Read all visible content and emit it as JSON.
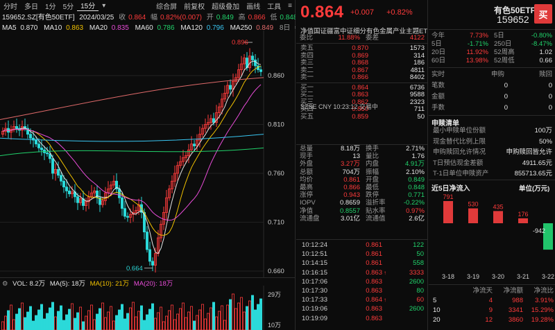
{
  "toolbar": {
    "tabs": [
      "分时",
      "多日",
      "1分",
      "5分",
      "15分"
    ],
    "selected_tab": "15分",
    "right_items": [
      "综合屏",
      "前复权",
      "超级叠加",
      "画线",
      "工具"
    ]
  },
  "info": {
    "symbol": "159652.SZ[有色50ETF]",
    "date": "2024/03/25",
    "close_label": "收",
    "close": "0.864",
    "amp_label": "幅",
    "amp": "0.82%(0.007)",
    "open_label": "开",
    "open": "0.849",
    "high_label": "高",
    "high": "0.866",
    "low_label": "低",
    "low": "0.848"
  },
  "ma": [
    {
      "label": "MA5",
      "value": "0.870",
      "color": "#e6e6e6"
    },
    {
      "label": "MA10",
      "value": "0.863",
      "color": "#f2c200"
    },
    {
      "label": "MA20",
      "value": "0.835",
      "color": "#e84cd8"
    },
    {
      "label": "MA60",
      "value": "0.786",
      "color": "#21d36b"
    },
    {
      "label": "MA120",
      "value": "0.796",
      "color": "#39c6f2"
    },
    {
      "label": "MA250",
      "value": "0.849",
      "color": "#e06a6a"
    }
  ],
  "ma_extra": "8日",
  "price_axis": [
    "0.860",
    "0.810",
    "0.760",
    "0.710",
    "0.660"
  ],
  "kline_marks": {
    "high": "0.896",
    "low": "0.664"
  },
  "volume": {
    "vol": "VOL: 8.2万",
    "ma5": "MA(5): 18万",
    "ma10": "MA(10): 21万",
    "ma20": "MA(20): 18万",
    "axis_top": "29万",
    "axis_mid": "10万"
  },
  "quote": {
    "price": "0.864",
    "change": "+0.007",
    "pct": "+0.82%",
    "fund_name": "净值国证疆富中证细分有色金属产业主题ET",
    "webi_label": "委比",
    "webi": "11.88%",
    "weicha_label": "委差",
    "weicha": "4122"
  },
  "sells": [
    {
      "label": "卖五",
      "price": "0.870",
      "vol": "1573"
    },
    {
      "label": "卖四",
      "price": "0.869",
      "vol": "314"
    },
    {
      "label": "卖三",
      "price": "0.868",
      "vol": "186"
    },
    {
      "label": "卖二",
      "price": "0.867",
      "vol": "4811"
    },
    {
      "label": "卖一",
      "price": "0.866",
      "vol": "8402"
    }
  ],
  "buys": [
    {
      "label": "买一",
      "price": "0.864",
      "vol": "6736"
    },
    {
      "label": "买二",
      "price": "0.863",
      "vol": "9588"
    },
    {
      "label": "买三",
      "price": "0.862",
      "vol": "2323"
    },
    {
      "label": "买四",
      "price": "0.860",
      "vol": "711"
    },
    {
      "label": "买五",
      "price": "0.859",
      "vol": "50"
    }
  ],
  "tz": "SZSE  CNY  10:23:12  交易中",
  "stats": [
    {
      "l1": "总量",
      "v1": "8.18万",
      "c1": "white",
      "l2": "换手",
      "v2": "2.71%",
      "c2": "white"
    },
    {
      "l1": "现手",
      "v1": "13",
      "c1": "white",
      "l2": "量比",
      "v2": "1.76",
      "c2": "white"
    },
    {
      "l1": "外盘",
      "v1": "3.27万",
      "c1": "red",
      "l2": "内盘",
      "v2": "4.91万",
      "c2": "green"
    },
    {
      "l1": "总额",
      "v1": "704万",
      "c1": "white",
      "l2": "振幅",
      "v2": "2.10%",
      "c2": "white"
    },
    {
      "l1": "均价",
      "v1": "0.861",
      "c1": "red",
      "l2": "开盘",
      "v2": "0.849",
      "c2": "green"
    },
    {
      "l1": "最高",
      "v1": "0.866",
      "c1": "red",
      "l2": "最低",
      "v2": "0.848",
      "c2": "green"
    },
    {
      "l1": "涨停",
      "v1": "0.943",
      "c1": "red",
      "l2": "跌停",
      "v2": "0.771",
      "c2": "green"
    },
    {
      "l1": "IOPV",
      "v1": "0.8659",
      "c1": "white",
      "l2": "溢折率",
      "v2": "-0.22%",
      "c2": "green"
    },
    {
      "l1": "净值",
      "v1": "0.8557",
      "c1": "green",
      "l2": "贴水率",
      "v2": "0.97%",
      "c2": "red"
    },
    {
      "l1": "流通盘",
      "v1": "3.01亿",
      "c1": "white",
      "l2": "流通值",
      "v2": "2.6亿",
      "c2": "white"
    }
  ],
  "ticks": [
    {
      "time": "10:12:24",
      "price": "0.861",
      "arrow": "",
      "vol": "122",
      "pc": "red",
      "vc": "green"
    },
    {
      "time": "10:12:51",
      "price": "0.861",
      "arrow": "",
      "vol": "50",
      "pc": "red",
      "vc": "green"
    },
    {
      "time": "10:14:15",
      "price": "0.861",
      "arrow": "",
      "vol": "558",
      "pc": "red",
      "vc": "green"
    },
    {
      "time": "10:16:15",
      "price": "0.863",
      "arrow": "↑",
      "vol": "3333",
      "pc": "red",
      "vc": "red"
    },
    {
      "time": "10:17:06",
      "price": "0.863",
      "arrow": "",
      "vol": "2600",
      "pc": "red",
      "vc": "green"
    },
    {
      "time": "10:17:30",
      "price": "0.863",
      "arrow": "",
      "vol": "80",
      "pc": "red",
      "vc": "green"
    },
    {
      "time": "10:17:33",
      "price": "0.864",
      "arrow": "↑",
      "vol": "60",
      "pc": "red",
      "vc": "red"
    },
    {
      "time": "10:19:06",
      "price": "0.863",
      "arrow": "",
      "vol": "2600",
      "pc": "red",
      "vc": "green"
    },
    {
      "time": "10:19:09",
      "price": "0.863",
      "arrow": "",
      "vol": "",
      "pc": "red",
      "vc": "green"
    }
  ],
  "right": {
    "name": "有色50ETF",
    "code": "159652",
    "buy_label": "买",
    "perf": [
      {
        "c1": "今年",
        "c2": "7.73%",
        "c2c": "red",
        "c3": "5日",
        "c4": "-0.80%",
        "c4c": "green"
      },
      {
        "c1": "5日",
        "c2": "-1.71%",
        "c2c": "green",
        "c3": "250日",
        "c4": "-8.47%",
        "c4c": "green"
      },
      {
        "c1": "20日",
        "c2": "11.92%",
        "c2c": "red",
        "c3": "52周高",
        "c4": "1.02",
        "c4c": "white"
      },
      {
        "c1": "60日",
        "c2": "13.98%",
        "c2c": "red",
        "c3": "52周低",
        "c4": "0.66",
        "c4c": "white"
      }
    ],
    "realtime_head": {
      "c1": "实时",
      "c3": "申购",
      "c4": "赎回"
    },
    "realtime": [
      {
        "label": "笔数",
        "a": "0",
        "b": "0"
      },
      {
        "label": "金额",
        "a": "0",
        "b": "0"
      },
      {
        "label": "手数",
        "a": "0",
        "b": "0"
      }
    ],
    "redeem_title": "申赎清单",
    "redeem": [
      {
        "k": "最小申赎单位份额",
        "v": "100万"
      },
      {
        "k": "现金替代比例上限",
        "v": "50%"
      },
      {
        "k": "申购赎回允许情况",
        "v": "申购赎回皆允许"
      },
      {
        "k": "T日预估现金差额",
        "v": "4911.65元"
      },
      {
        "k": "T-1日单位申赎资产",
        "v": "855713.65元"
      }
    ],
    "flow_title": "近5日净流入",
    "flow_unit": "单位(万元)",
    "flow_table_head": {
      "a": "",
      "b": "净流天",
      "c": "净流额",
      "d": "净流比"
    },
    "flow_table": [
      {
        "a": "5",
        "b": "4",
        "c": "988",
        "d": "3.91%"
      },
      {
        "a": "10",
        "b": "9",
        "c": "3341",
        "d": "15.29%"
      },
      {
        "a": "20",
        "b": "12",
        "c": "3860",
        "d": "19.28%"
      }
    ]
  },
  "chart_data": [
    {
      "type": "bar",
      "title": "近5日净流入",
      "unit": "单位(万元)",
      "categories": [
        "3-18",
        "3-19",
        "3-20",
        "3-21",
        "3-22"
      ],
      "values": [
        791,
        530,
        435,
        176,
        -942
      ],
      "colors": {
        "positive": "#e03a3a",
        "negative": "#21c46b"
      }
    }
  ]
}
